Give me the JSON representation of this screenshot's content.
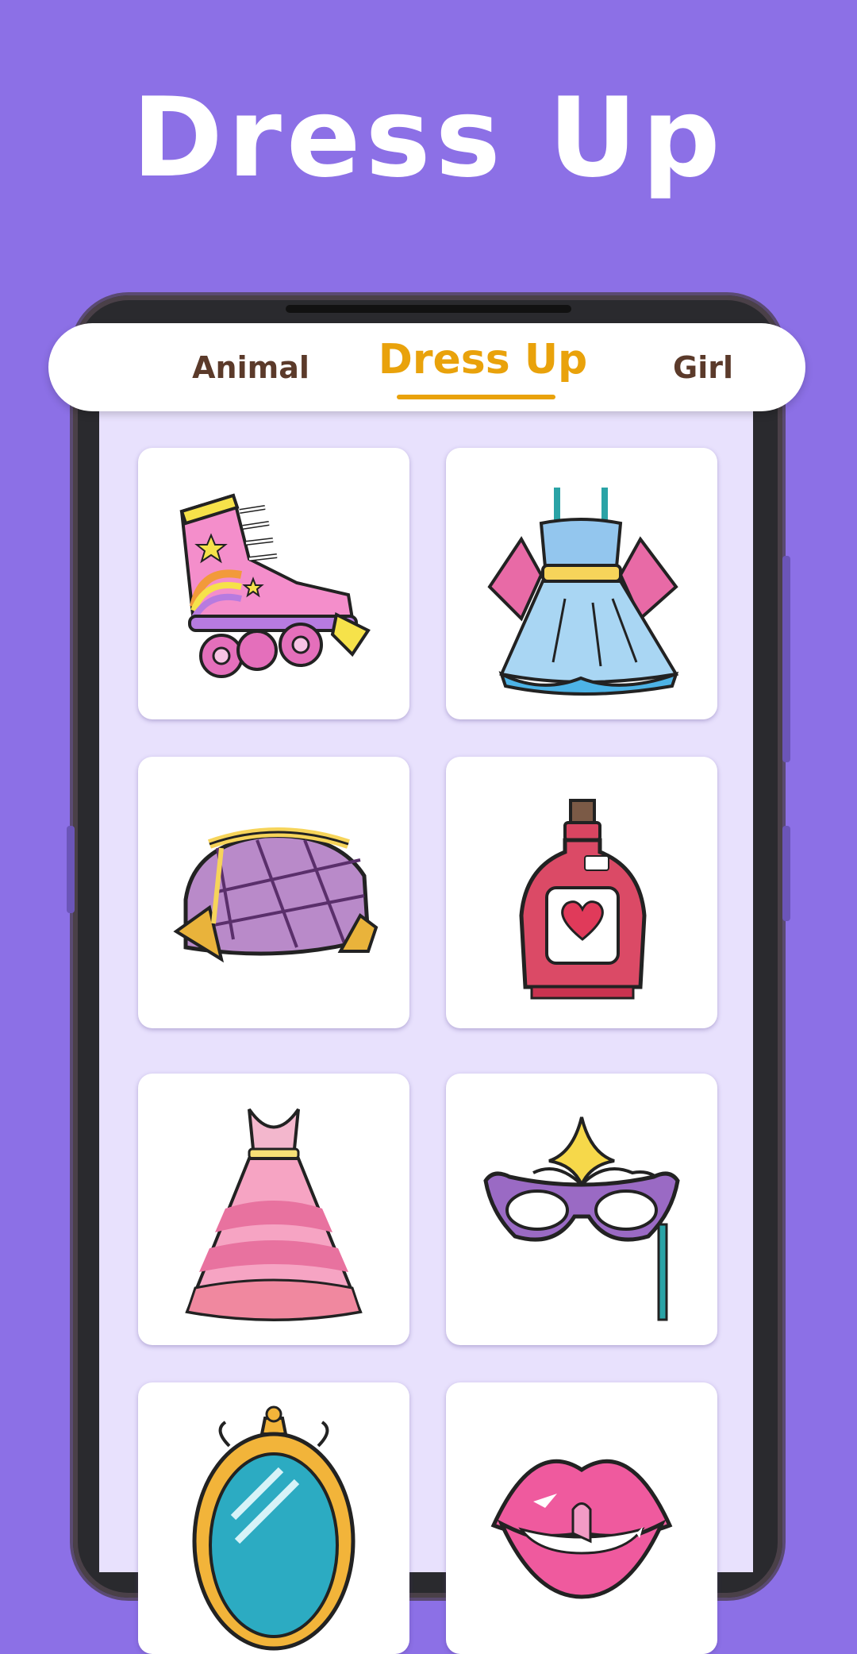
{
  "header": {
    "title": "Dress Up"
  },
  "tabs": [
    {
      "label": "Animal",
      "selected": false
    },
    {
      "label": "Dress Up",
      "selected": true
    },
    {
      "label": "Girl",
      "selected": false
    }
  ],
  "grid": {
    "items": [
      {
        "icon": "roller-skate-icon"
      },
      {
        "icon": "blue-dress-icon"
      },
      {
        "icon": "purse-icon"
      },
      {
        "icon": "perfume-bottle-icon"
      },
      {
        "icon": "pink-gown-icon"
      },
      {
        "icon": "masquerade-mask-icon"
      },
      {
        "icon": "mirror-icon"
      },
      {
        "icon": "lips-icon"
      }
    ]
  },
  "colors": {
    "background": "#8c70e6",
    "screen": "#e8e1fd",
    "active_tab": "#e9a20b",
    "inactive_tab": "#5b3a2a"
  }
}
